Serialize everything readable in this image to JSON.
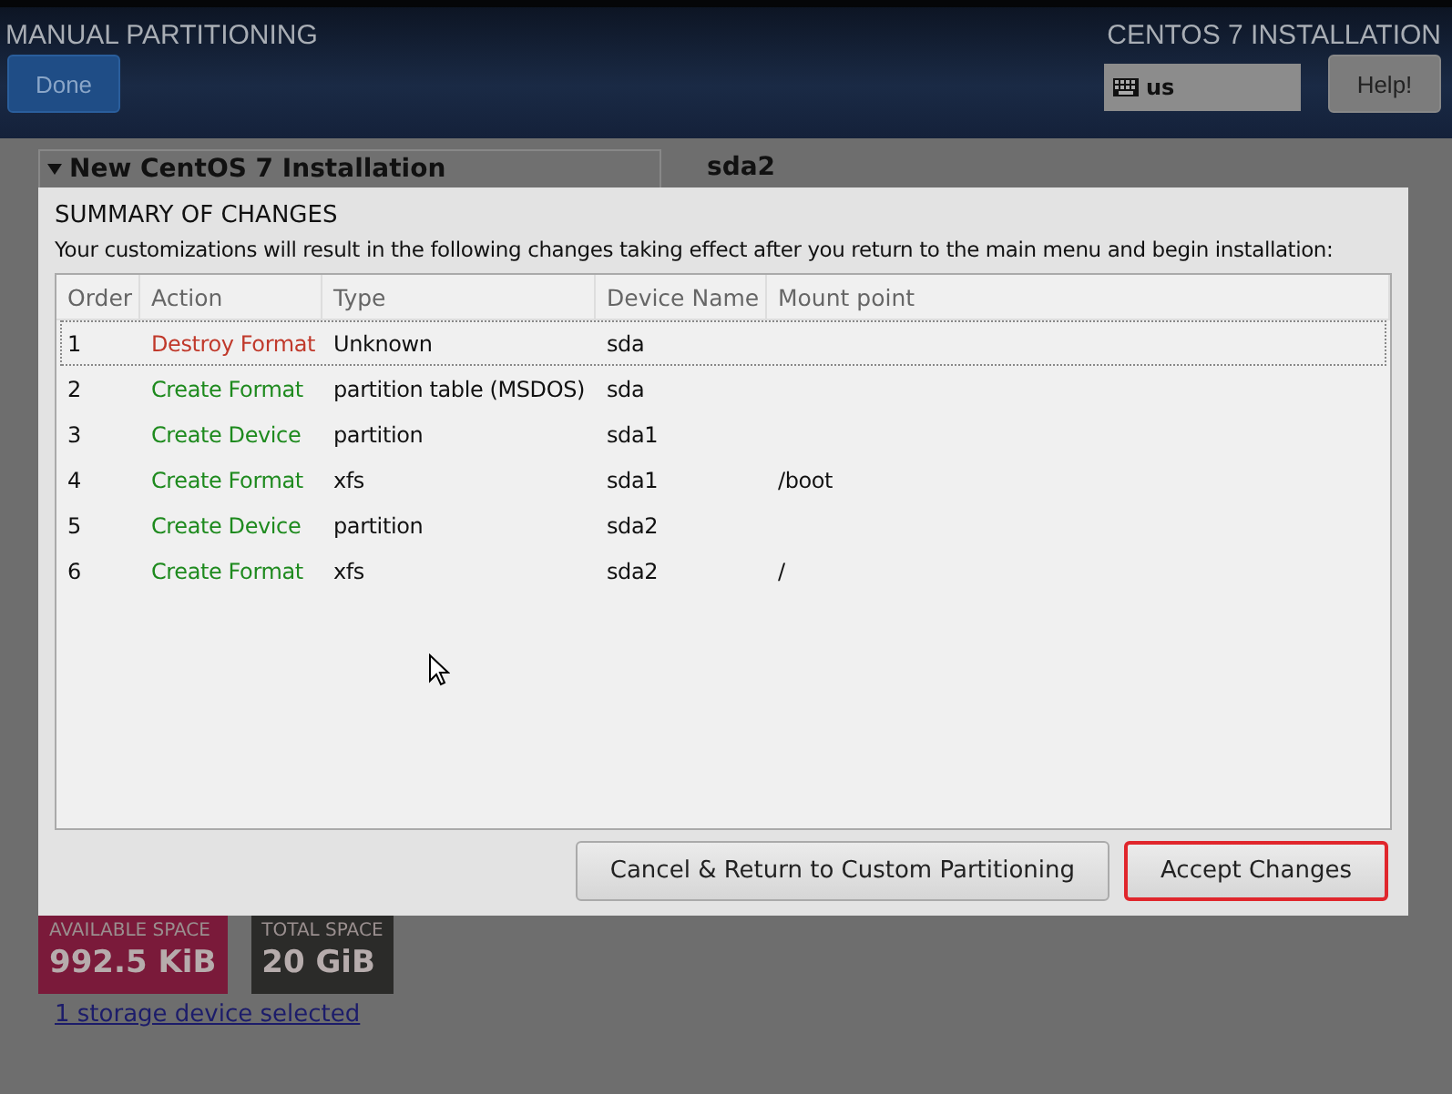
{
  "header": {
    "title": "MANUAL PARTITIONING",
    "done_button": "Done",
    "product": "CENTOS 7 INSTALLATION",
    "keyboard_layout": "us",
    "help_button": "Help!"
  },
  "background": {
    "install_group": "New CentOS 7 Installation",
    "device": "sda2",
    "available_space": {
      "label": "AVAILABLE SPACE",
      "value": "992.5 KiB"
    },
    "total_space": {
      "label": "TOTAL SPACE",
      "value": "20 GiB"
    },
    "storage_link": "1 storage device selected"
  },
  "dialog": {
    "title": "SUMMARY OF CHANGES",
    "message": "Your customizations will result in the following changes taking effect after you return to the main menu and begin installation:",
    "columns": [
      "Order",
      "Action",
      "Type",
      "Device Name",
      "Mount point"
    ],
    "rows": [
      {
        "order": "1",
        "action": "Destroy Format",
        "kind": "destroy",
        "type": "Unknown",
        "device": "sda",
        "mount": "",
        "selected": true
      },
      {
        "order": "2",
        "action": "Create Format",
        "kind": "create",
        "type": "partition table (MSDOS)",
        "device": "sda",
        "mount": "",
        "selected": false
      },
      {
        "order": "3",
        "action": "Create Device",
        "kind": "create",
        "type": "partition",
        "device": "sda1",
        "mount": "",
        "selected": false
      },
      {
        "order": "4",
        "action": "Create Format",
        "kind": "create",
        "type": "xfs",
        "device": "sda1",
        "mount": "/boot",
        "selected": false
      },
      {
        "order": "5",
        "action": "Create Device",
        "kind": "create",
        "type": "partition",
        "device": "sda2",
        "mount": "",
        "selected": false
      },
      {
        "order": "6",
        "action": "Create Format",
        "kind": "create",
        "type": "xfs",
        "device": "sda2",
        "mount": "/",
        "selected": false
      }
    ],
    "cancel_button": "Cancel & Return to Custom Partitioning",
    "accept_button": "Accept Changes"
  }
}
